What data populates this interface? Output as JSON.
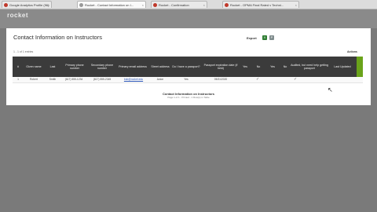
{
  "browser": {
    "tabs": [
      {
        "label": "Google Analytics Profile (96)",
        "active": false,
        "color": "#c0392b"
      },
      {
        "label": "Rocket - Contact Information on I...",
        "active": true,
        "color": "#999999"
      },
      {
        "label": "Rocket - Confirmation",
        "active": false,
        "color": "#c0392b"
      },
      {
        "label": "Rocket - OPMA Final Rated v Techni...",
        "active": false,
        "color": "#c0392b"
      }
    ]
  },
  "header": {
    "logo": "rocket"
  },
  "page": {
    "title": "Contact Information on Instructors",
    "export_label": "Export",
    "export_icons": [
      {
        "text": "X",
        "color": "#2e7d32"
      },
      {
        "text": "P",
        "color": "#7f8c8d"
      }
    ],
    "record_count": "1 - 1 of 1 entries",
    "actions_label": "Actions"
  },
  "table": {
    "columns": [
      "#",
      "Given name",
      "Last",
      "Primary phone number",
      "Secondary phone number",
      "Primary email address",
      "Street address",
      "Do I have a passport?",
      "Passport expiration date (if held)",
      "Yes",
      "No",
      "Yes",
      "No",
      "Audited, but need help getting passport",
      "Last Updated"
    ],
    "row": {
      "num": "1",
      "given": "Robert",
      "last": "Smith",
      "phone1": "(617) 555-1234",
      "phone2": "(617) 555-2345",
      "email": "bob@rocket.edu",
      "street": "Acton",
      "passport": "Yes",
      "expiration": "05/31/2020"
    }
  },
  "footer": {
    "title": "Contact Information on Instructors",
    "subtitle": "Page 1 of 1 - Printed - 1 Row(s) in Table"
  }
}
